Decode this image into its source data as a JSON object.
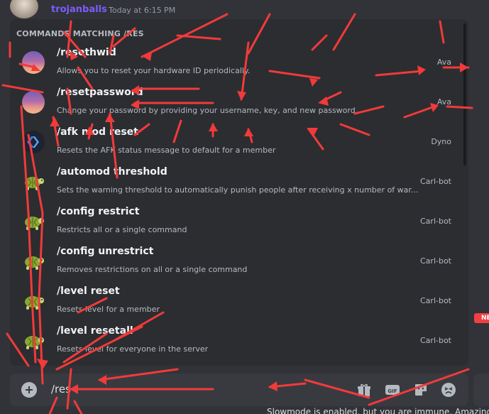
{
  "message": {
    "username": "trojanballs",
    "timestamp": "Today at 6:15 PM"
  },
  "autocomplete": {
    "header": "COMMANDS MATCHING /RES",
    "commands": [
      {
        "name": "/resethwid",
        "description": "Allows you to reset your hardware ID periodically.",
        "source": "Ava",
        "icon": "sunset-avatar"
      },
      {
        "name": "/resetpassword",
        "description": "Change your password by providing your username, key, and new password.",
        "source": "Ava",
        "icon": "sunset-avatar"
      },
      {
        "name": "/afk mod reset",
        "description": "Resets the AFK status message to default for a member",
        "source": "Dyno",
        "icon": "dyno-avatar"
      },
      {
        "name": "/automod threshold",
        "description": "Sets the warning threshold to automatically punish people after receiving x number of war...",
        "source": "Carl-bot",
        "icon": "turtle-avatar"
      },
      {
        "name": "/config restrict",
        "description": "Restricts all or a single command",
        "source": "Carl-bot",
        "icon": "turtle-avatar"
      },
      {
        "name": "/config unrestrict",
        "description": "Removes restrictions on all or a single command",
        "source": "Carl-bot",
        "icon": "turtle-avatar"
      },
      {
        "name": "/level reset",
        "description": "Resets level for a member",
        "source": "Carl-bot",
        "icon": "turtle-avatar"
      },
      {
        "name": "/level resetall",
        "description": "Resets level for everyone in the server",
        "source": "Carl-bot",
        "icon": "turtle-avatar"
      }
    ]
  },
  "composer": {
    "value": "/res",
    "buttons": [
      "gift-icon",
      "gif-icon",
      "sticker-icon",
      "emoji-icon"
    ],
    "gif_label": "GIF"
  },
  "badge": {
    "new_label": "NEW"
  },
  "footer": {
    "slowmode": "Slowmode is enabled, but you are immune. Amazing!"
  },
  "colors": {
    "accent_user": "#7c5cff",
    "scribble": "#f23a3a",
    "badge": "#f23f43"
  }
}
